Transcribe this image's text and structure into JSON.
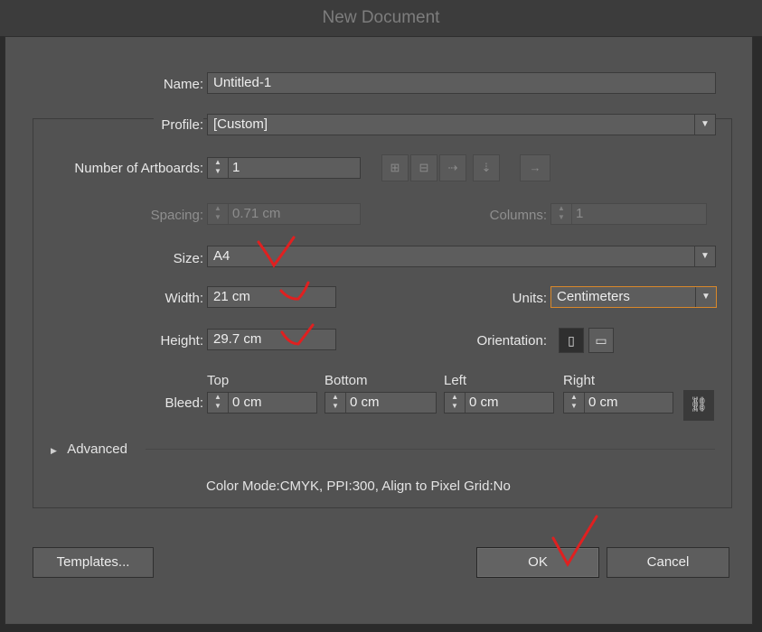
{
  "window": {
    "title": "New Document"
  },
  "form": {
    "name_label": "Name:",
    "name_value": "Untitled-1",
    "profile_label": "Profile:",
    "profile_value": "[Custom]",
    "artboards_label": "Number of Artboards:",
    "artboards_value": "1",
    "spacing_label": "Spacing:",
    "spacing_value": "0.71 cm",
    "columns_label": "Columns:",
    "columns_value": "1",
    "size_label": "Size:",
    "size_value": "A4",
    "width_label": "Width:",
    "width_value": "21 cm",
    "height_label": "Height:",
    "height_value": "29.7 cm",
    "units_label": "Units:",
    "units_value": "Centimeters",
    "orientation_label": "Orientation:",
    "bleed_label": "Bleed:",
    "bleed": {
      "top_label": "Top",
      "top_value": "0 cm",
      "bottom_label": "Bottom",
      "bottom_value": "0 cm",
      "left_label": "Left",
      "left_value": "0 cm",
      "right_label": "Right",
      "right_value": "0 cm"
    },
    "advanced_label": "Advanced",
    "summary": "Color Mode:CMYK, PPI:300, Align to Pixel Grid:No"
  },
  "buttons": {
    "templates": "Templates...",
    "ok": "OK",
    "cancel": "Cancel"
  },
  "icons": {
    "arrange_grid_by_row": "grid-by-row-icon",
    "arrange_grid_by_column": "grid-by-column-icon",
    "arrange_by_row": "arrange-by-row-icon",
    "arrange_by_column": "arrange-by-column-icon",
    "right_to_left": "right-to-left-icon",
    "portrait": "portrait-icon",
    "landscape": "landscape-icon",
    "link": "link-icon",
    "disclosure": "disclosure-triangle-icon"
  },
  "colors": {
    "focus_border": "#d9882a",
    "annotation_mark": "#e02020"
  }
}
